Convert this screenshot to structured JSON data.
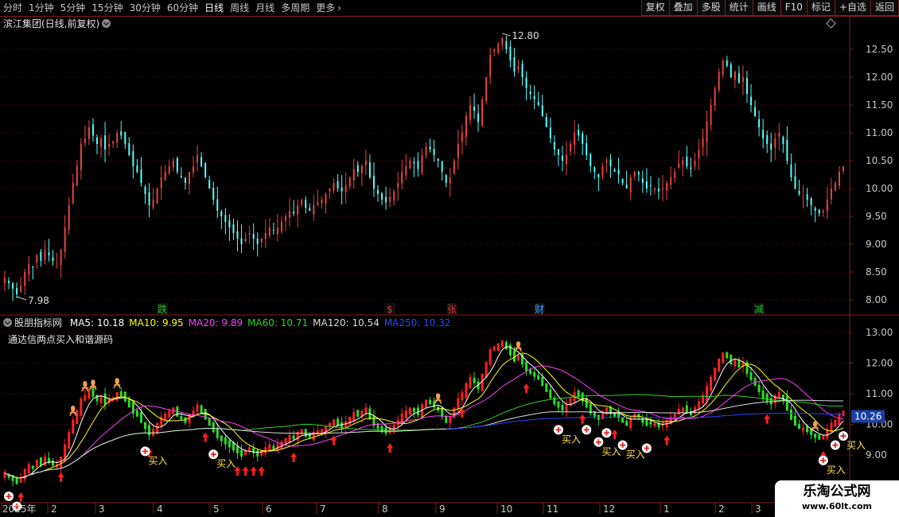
{
  "topbar": {
    "tabs": [
      "分时",
      "1分钟",
      "5分钟",
      "15分钟",
      "30分钟",
      "60分钟",
      "日线",
      "周线",
      "月线",
      "多周期",
      "更多"
    ],
    "active_tab": "日线",
    "more_icon": "chevron-right-icon",
    "tools": [
      "复权",
      "叠加",
      "多股",
      "统计",
      "画线",
      "F10",
      "标记",
      "+自选",
      "返回"
    ]
  },
  "main_panel": {
    "title": "滨江集团(日线,前复权)",
    "high_label": "12.80",
    "low_label": "7.98",
    "y_ticks": [
      "12.50",
      "12.00",
      "11.50",
      "11.00",
      "10.50",
      "10.00",
      "9.50",
      "9.00",
      "8.50",
      "8.00"
    ],
    "markers": [
      {
        "text": "跌",
        "color": "#19c419"
      },
      {
        "text": "$",
        "color": "#e03030"
      },
      {
        "text": "张",
        "color": "#e03030"
      },
      {
        "text": "财",
        "color": "#3fa0ff"
      },
      {
        "text": "减",
        "color": "#19c419"
      }
    ]
  },
  "indicator_panel": {
    "title": "股朋指标网",
    "ma": [
      {
        "label": "MA5: 10.18",
        "color": "#ffffff"
      },
      {
        "label": "MA10: 9.95",
        "color": "#ffff00"
      },
      {
        "label": "MA20: 9.89",
        "color": "#ff3cff"
      },
      {
        "label": "MA60: 10.71",
        "color": "#2ad42a"
      },
      {
        "label": "MA120: 10.54",
        "color": "#dcdcdc"
      },
      {
        "label": "MA250: 10.32",
        "color": "#2b46ff"
      }
    ],
    "subtitle": "通达信两点买入和谐源码",
    "buy_label": "买入",
    "y_ticks": [
      "13.00",
      "12.00",
      "11.00",
      "10.00",
      "9.00"
    ],
    "current_price": "10.26"
  },
  "x_axis": {
    "labels": [
      "2025年",
      "2",
      "3",
      "4",
      "5",
      "6",
      "7",
      "8",
      "9",
      "10",
      "11",
      "12",
      "1",
      "2",
      "3"
    ]
  },
  "watermark": {
    "name": "乐淘公式网",
    "url": "www.60lt.com"
  },
  "colors": {
    "up": "#e8453c",
    "down": "#54ffff",
    "ind_up": "#ff2020",
    "ind_down": "#28e028",
    "axis": "#8a1c1c"
  },
  "price_series": [
    8.4,
    8.3,
    8.2,
    8.1,
    8.25,
    8.5,
    8.65,
    8.6,
    8.8,
    8.7,
    8.9,
    8.8,
    8.7,
    8.65,
    8.9,
    9.3,
    9.7,
    10.1,
    10.4,
    10.8,
    10.9,
    11.1,
    10.95,
    10.8,
    10.9,
    10.7,
    10.8,
    10.85,
    11.0,
    10.95,
    10.8,
    10.6,
    10.4,
    10.3,
    10.1,
    9.9,
    9.7,
    9.8,
    10.0,
    10.2,
    10.3,
    10.4,
    10.5,
    10.3,
    10.2,
    10.1,
    10.3,
    10.4,
    10.6,
    10.4,
    10.2,
    10.0,
    9.8,
    9.6,
    9.5,
    9.4,
    9.3,
    9.2,
    9.1,
    9.0,
    9.1,
    9.2,
    9.1,
    9.0,
    9.1,
    9.2,
    9.3,
    9.25,
    9.3,
    9.4,
    9.5,
    9.6,
    9.55,
    9.7,
    9.8,
    9.65,
    9.6,
    9.7,
    9.75,
    9.8,
    9.9,
    10.0,
    10.1,
    10.0,
    9.95,
    10.05,
    10.2,
    10.35,
    10.3,
    10.4,
    10.5,
    10.2,
    10.0,
    9.9,
    9.8,
    9.75,
    9.85,
    9.95,
    10.1,
    10.3,
    10.4,
    10.5,
    10.45,
    10.35,
    10.6,
    10.75,
    10.7,
    10.6,
    10.5,
    10.3,
    10.1,
    10.2,
    10.5,
    10.8,
    11.0,
    11.3,
    11.5,
    11.4,
    11.2,
    11.6,
    12.0,
    12.4,
    12.5,
    12.6,
    12.7,
    12.5,
    12.3,
    12.1,
    12.2,
    12.0,
    11.8,
    11.7,
    11.6,
    11.5,
    11.3,
    11.1,
    10.9,
    10.7,
    10.6,
    10.5,
    10.6,
    10.8,
    11.0,
    10.95,
    10.8,
    10.6,
    10.4,
    10.3,
    10.2,
    10.4,
    10.5,
    10.4,
    10.3,
    10.25,
    10.1,
    10.0,
    10.2,
    10.3,
    10.25,
    10.1,
    10.0,
    10.05,
    10.0,
    9.95,
    10.0,
    10.1,
    10.2,
    10.3,
    10.45,
    10.5,
    10.4,
    10.35,
    10.5,
    10.7,
    10.9,
    11.2,
    11.5,
    11.8,
    12.1,
    12.3,
    12.2,
    12.0,
    12.1,
    11.9,
    12.0,
    11.7,
    11.5,
    11.3,
    11.1,
    10.9,
    10.8,
    10.7,
    10.9,
    11.0,
    10.8,
    10.5,
    10.2,
    10.0,
    9.9,
    9.85,
    9.8,
    9.7,
    9.6,
    9.55,
    9.6,
    9.8,
    10.0,
    10.1,
    10.3,
    10.4
  ]
}
